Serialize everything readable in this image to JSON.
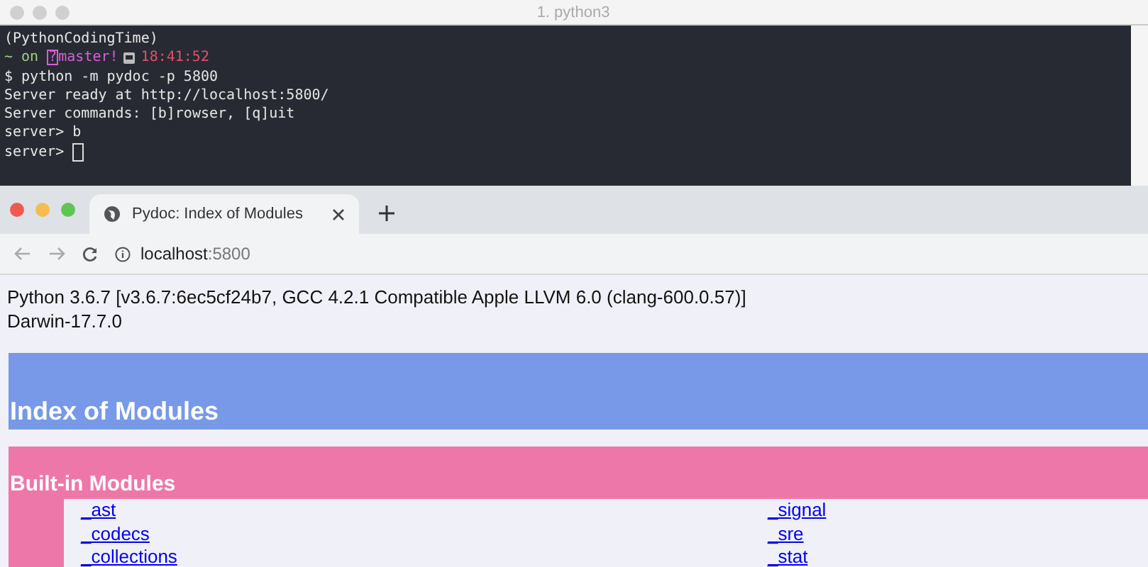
{
  "terminal": {
    "title": "1. python3",
    "lines": [
      [
        {
          "text": "(PythonCodingTime)",
          "kind": "plain"
        }
      ],
      [
        {
          "text": "~ on ",
          "kind": "dim"
        },
        {
          "text": "?",
          "kind": "badge"
        },
        {
          "text": "master!",
          "kind": "branch"
        },
        {
          "kind": "clock"
        },
        {
          "text": "18:41:52",
          "kind": "time"
        }
      ],
      [
        {
          "text": "$ python -m pydoc -p 5800",
          "kind": "plain"
        }
      ],
      [
        {
          "text": "Server ready at http://localhost:5800/",
          "kind": "plain"
        }
      ],
      [
        {
          "text": "Server commands: [b]rowser, [q]uit",
          "kind": "plain"
        }
      ],
      [
        {
          "text": "server> b",
          "kind": "plain"
        }
      ],
      [
        {
          "text": "server> ",
          "kind": "plain"
        },
        {
          "kind": "cursor"
        }
      ]
    ]
  },
  "browser": {
    "tab": {
      "title": "Pydoc: Index of Modules",
      "selected": true
    },
    "address": {
      "host": "localhost",
      "port": ":5800"
    },
    "page": {
      "version_lines": [
        "Python 3.6.7 [v3.6.7:6ec5cf24b7, GCC 4.2.1 Compatible Apple LLVM 6.0 (clang-600.0.57)]",
        "Darwin-17.7.0"
      ],
      "title": "Index of Modules",
      "section": {
        "title": "Built-in Modules",
        "columns": [
          [
            "_ast",
            "_codecs",
            "_collections"
          ],
          [
            "_signal",
            "_sre",
            "_stat"
          ]
        ]
      }
    }
  }
}
